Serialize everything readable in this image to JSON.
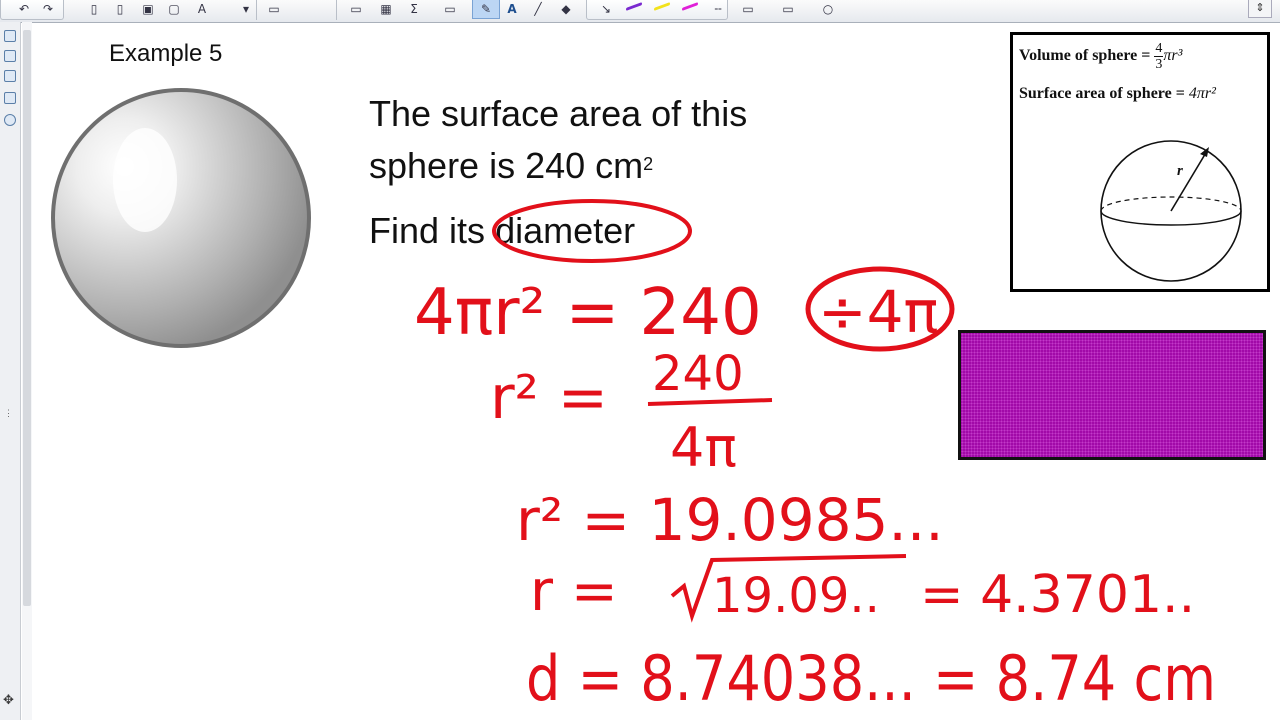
{
  "toolbar": {
    "tools": [
      "undo-icon",
      "redo-icon",
      "new-page-icon",
      "delete-page-icon",
      "save-icon",
      "screen-shade-icon",
      "text-recognition-icon",
      "capture-icon",
      "insert-table-icon",
      "math-icon",
      "pen-icon",
      "text-tool-icon",
      "line-icon",
      "eraser-icon",
      "pen-arrow-icon",
      "pen-purple-icon",
      "pen-yellow-icon",
      "pen-magenta-icon",
      "pen-dashed-icon"
    ],
    "scroll_label": "⇕",
    "colors": {
      "purple": "#7a2ad0",
      "yellow": "#f2e21c",
      "magenta": "#e020d8"
    }
  },
  "slide": {
    "example_title": "Example 5",
    "problem_line1": "The surface area of this",
    "problem_line2_prefix": "sphere is 240 cm",
    "problem_line2_sup": "2",
    "find_prefix": "Find its",
    "find_word": "diameter",
    "formula_box": {
      "volume_label": "Volume of sphere =",
      "volume_num": "4",
      "volume_den": "3",
      "volume_rest": "πr³",
      "surface_label": "Surface area of sphere =",
      "surface_expr": "4πr²",
      "radius_label": "r"
    },
    "colors": {
      "ink": "#e2101a",
      "block": "#a10aa8"
    }
  },
  "handwriting": {
    "line1_left": "4πr² = 240",
    "line1_circled": "÷4π",
    "line2_lhs": "r² =",
    "line2_num": "240",
    "line2_den": "4π",
    "line3": "r² = 19.0985...",
    "line4_lhs": "r =",
    "line4_sqrt_arg": "19.09..",
    "line4_result": "= 4.3701..",
    "line5": "d = 8.74038... = 8.74 cm"
  }
}
